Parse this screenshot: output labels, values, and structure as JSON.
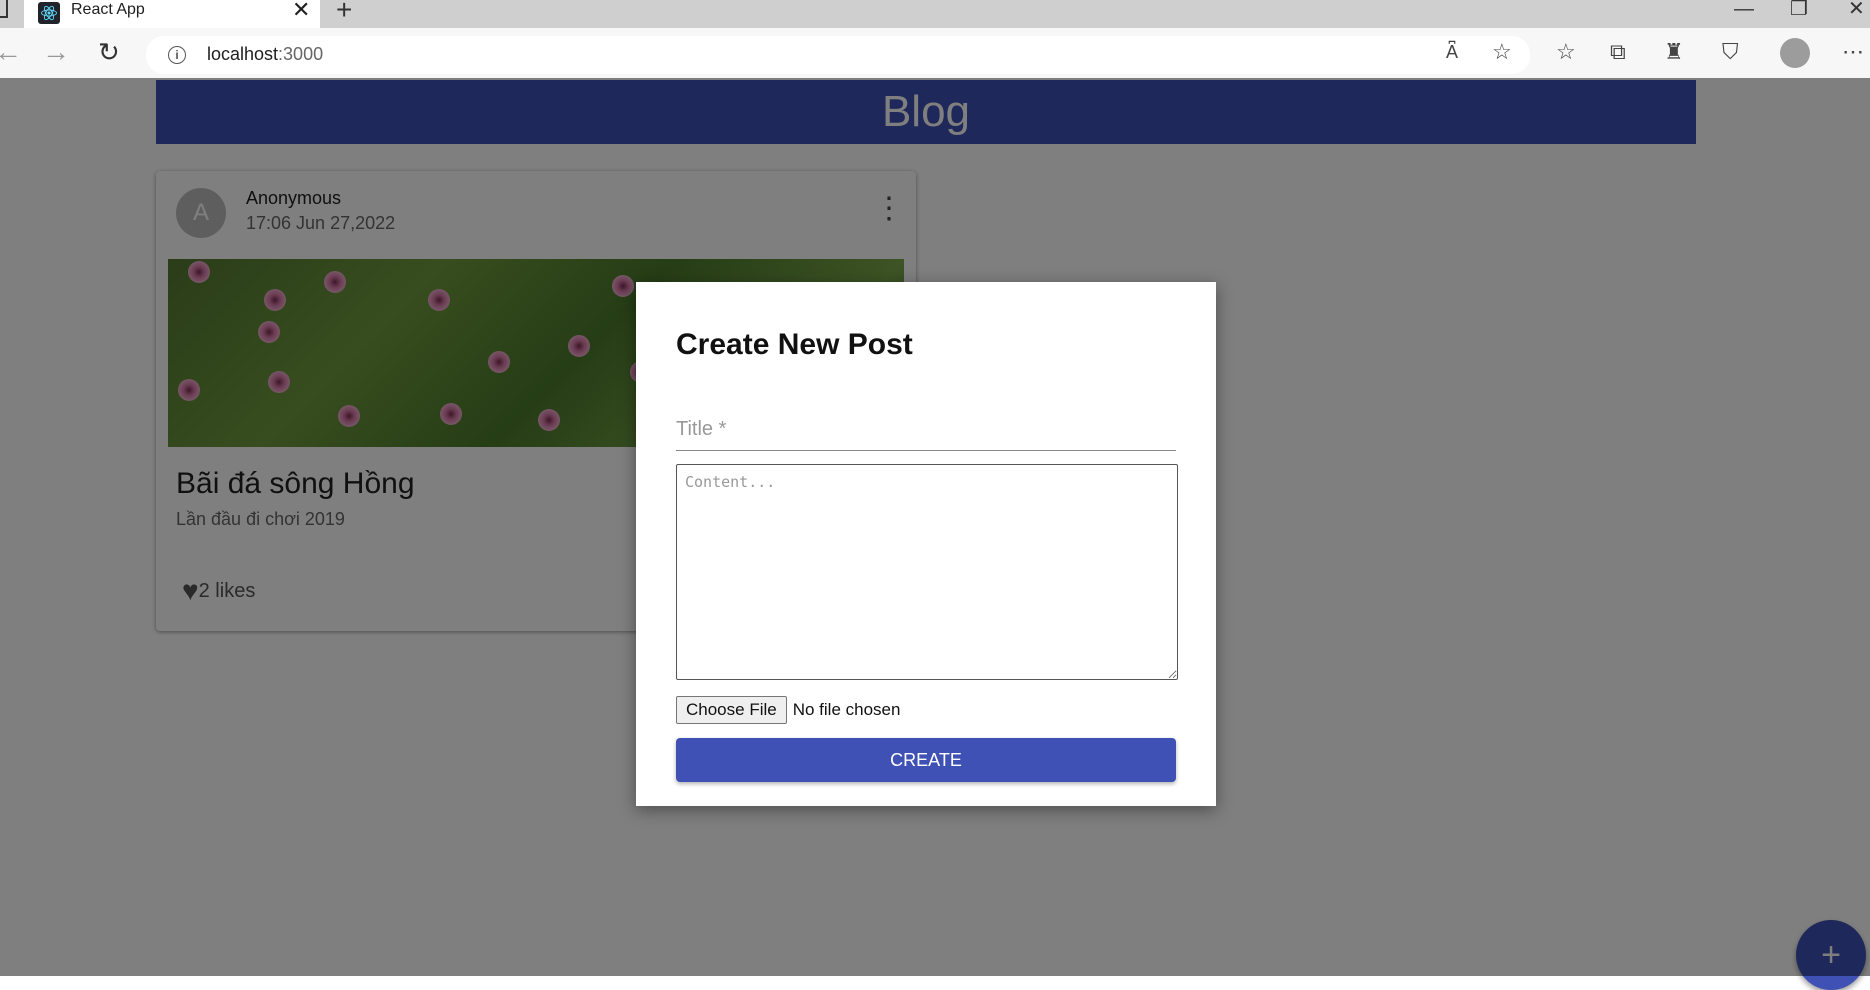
{
  "browser": {
    "tab_title": "React App",
    "tab_close_glyph": "✕",
    "new_tab_glyph": "+",
    "url_host": "localhost",
    "url_port": ":3000",
    "window_controls": {
      "minimize": "—",
      "restore": "❐",
      "close": "✕"
    },
    "toolbar_icons": [
      "read-aloud-icon",
      "add-favorite-icon",
      "favorites-icon",
      "collections-icon",
      "extensions-icon",
      "browser-essentials-icon",
      "profile-icon",
      "more-icon"
    ]
  },
  "header": {
    "title": "Blog"
  },
  "post": {
    "avatar_letter": "A",
    "author": "Anonymous",
    "date": "17:06 Jun 27,2022",
    "title": "Bãi đá sông Hồng",
    "subtitle": "Lần đầu đi chơi 2019",
    "likes_label": "2 likes"
  },
  "modal": {
    "title": "Create New Post",
    "title_placeholder": "Title *",
    "content_placeholder": "Content...",
    "file_button_label": "Choose File",
    "file_status": "No file chosen",
    "create_label": "CREATE"
  },
  "fab": {
    "label": "+"
  },
  "colors": {
    "primary": "#3f51b5",
    "overlay": "rgba(0,0,0,0.5)"
  }
}
